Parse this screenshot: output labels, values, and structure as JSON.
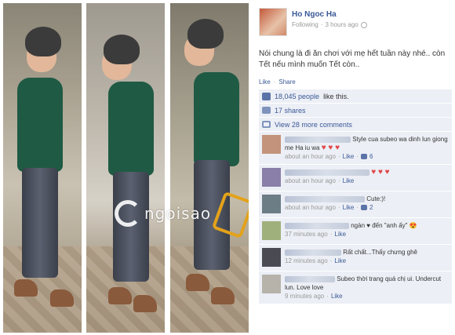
{
  "watermark": {
    "text": "ngoisao"
  },
  "post": {
    "author": "Ho Ngoc Ha",
    "audience": "Following",
    "time": "3 hours ago",
    "message": "Nói chung là đi ăn chơi với mẹ hết tuần này nhé.. còn Tết nếu mình muốn Tết còn..",
    "actions": [
      "Like",
      "Share"
    ],
    "likes_text": "18,045 people",
    "likes_suffix": "like this.",
    "shares_text": "17 shares",
    "more_comments": "View 28 more comments",
    "icons": {
      "like": "thumbs-up-icon",
      "share": "share-icon",
      "comments": "comment-icon",
      "globe": "globe-icon"
    }
  },
  "comments": [
    {
      "text": "Style cua subeo wa dinh lun giong me Ha iu wa",
      "hearts": "♥ ♥ ♥",
      "time": "about an hour ago",
      "like": "Like",
      "likes": "6"
    },
    {
      "text": "",
      "hearts": "♥ ♥ ♥",
      "time": "about an hour ago",
      "like": "Like",
      "likes": ""
    },
    {
      "text": "Cute:)!",
      "hearts": "",
      "time": "about an hour ago",
      "like": "Like",
      "likes": "2"
    },
    {
      "text": "ngàn ♥ đến \"anh ấy\" 😍",
      "hearts": "",
      "time": "37 minutes ago",
      "like": "Like",
      "likes": ""
    },
    {
      "text": "Rất chất...Thấy chưng ghê",
      "hearts": "",
      "time": "12 minutes ago",
      "like": "Like",
      "likes": ""
    },
    {
      "text": "Subeo thời trang quá chị ui. Undercut lun. Love love",
      "hearts": "",
      "time": "9 minutes ago",
      "like": "Like",
      "likes": ""
    }
  ]
}
